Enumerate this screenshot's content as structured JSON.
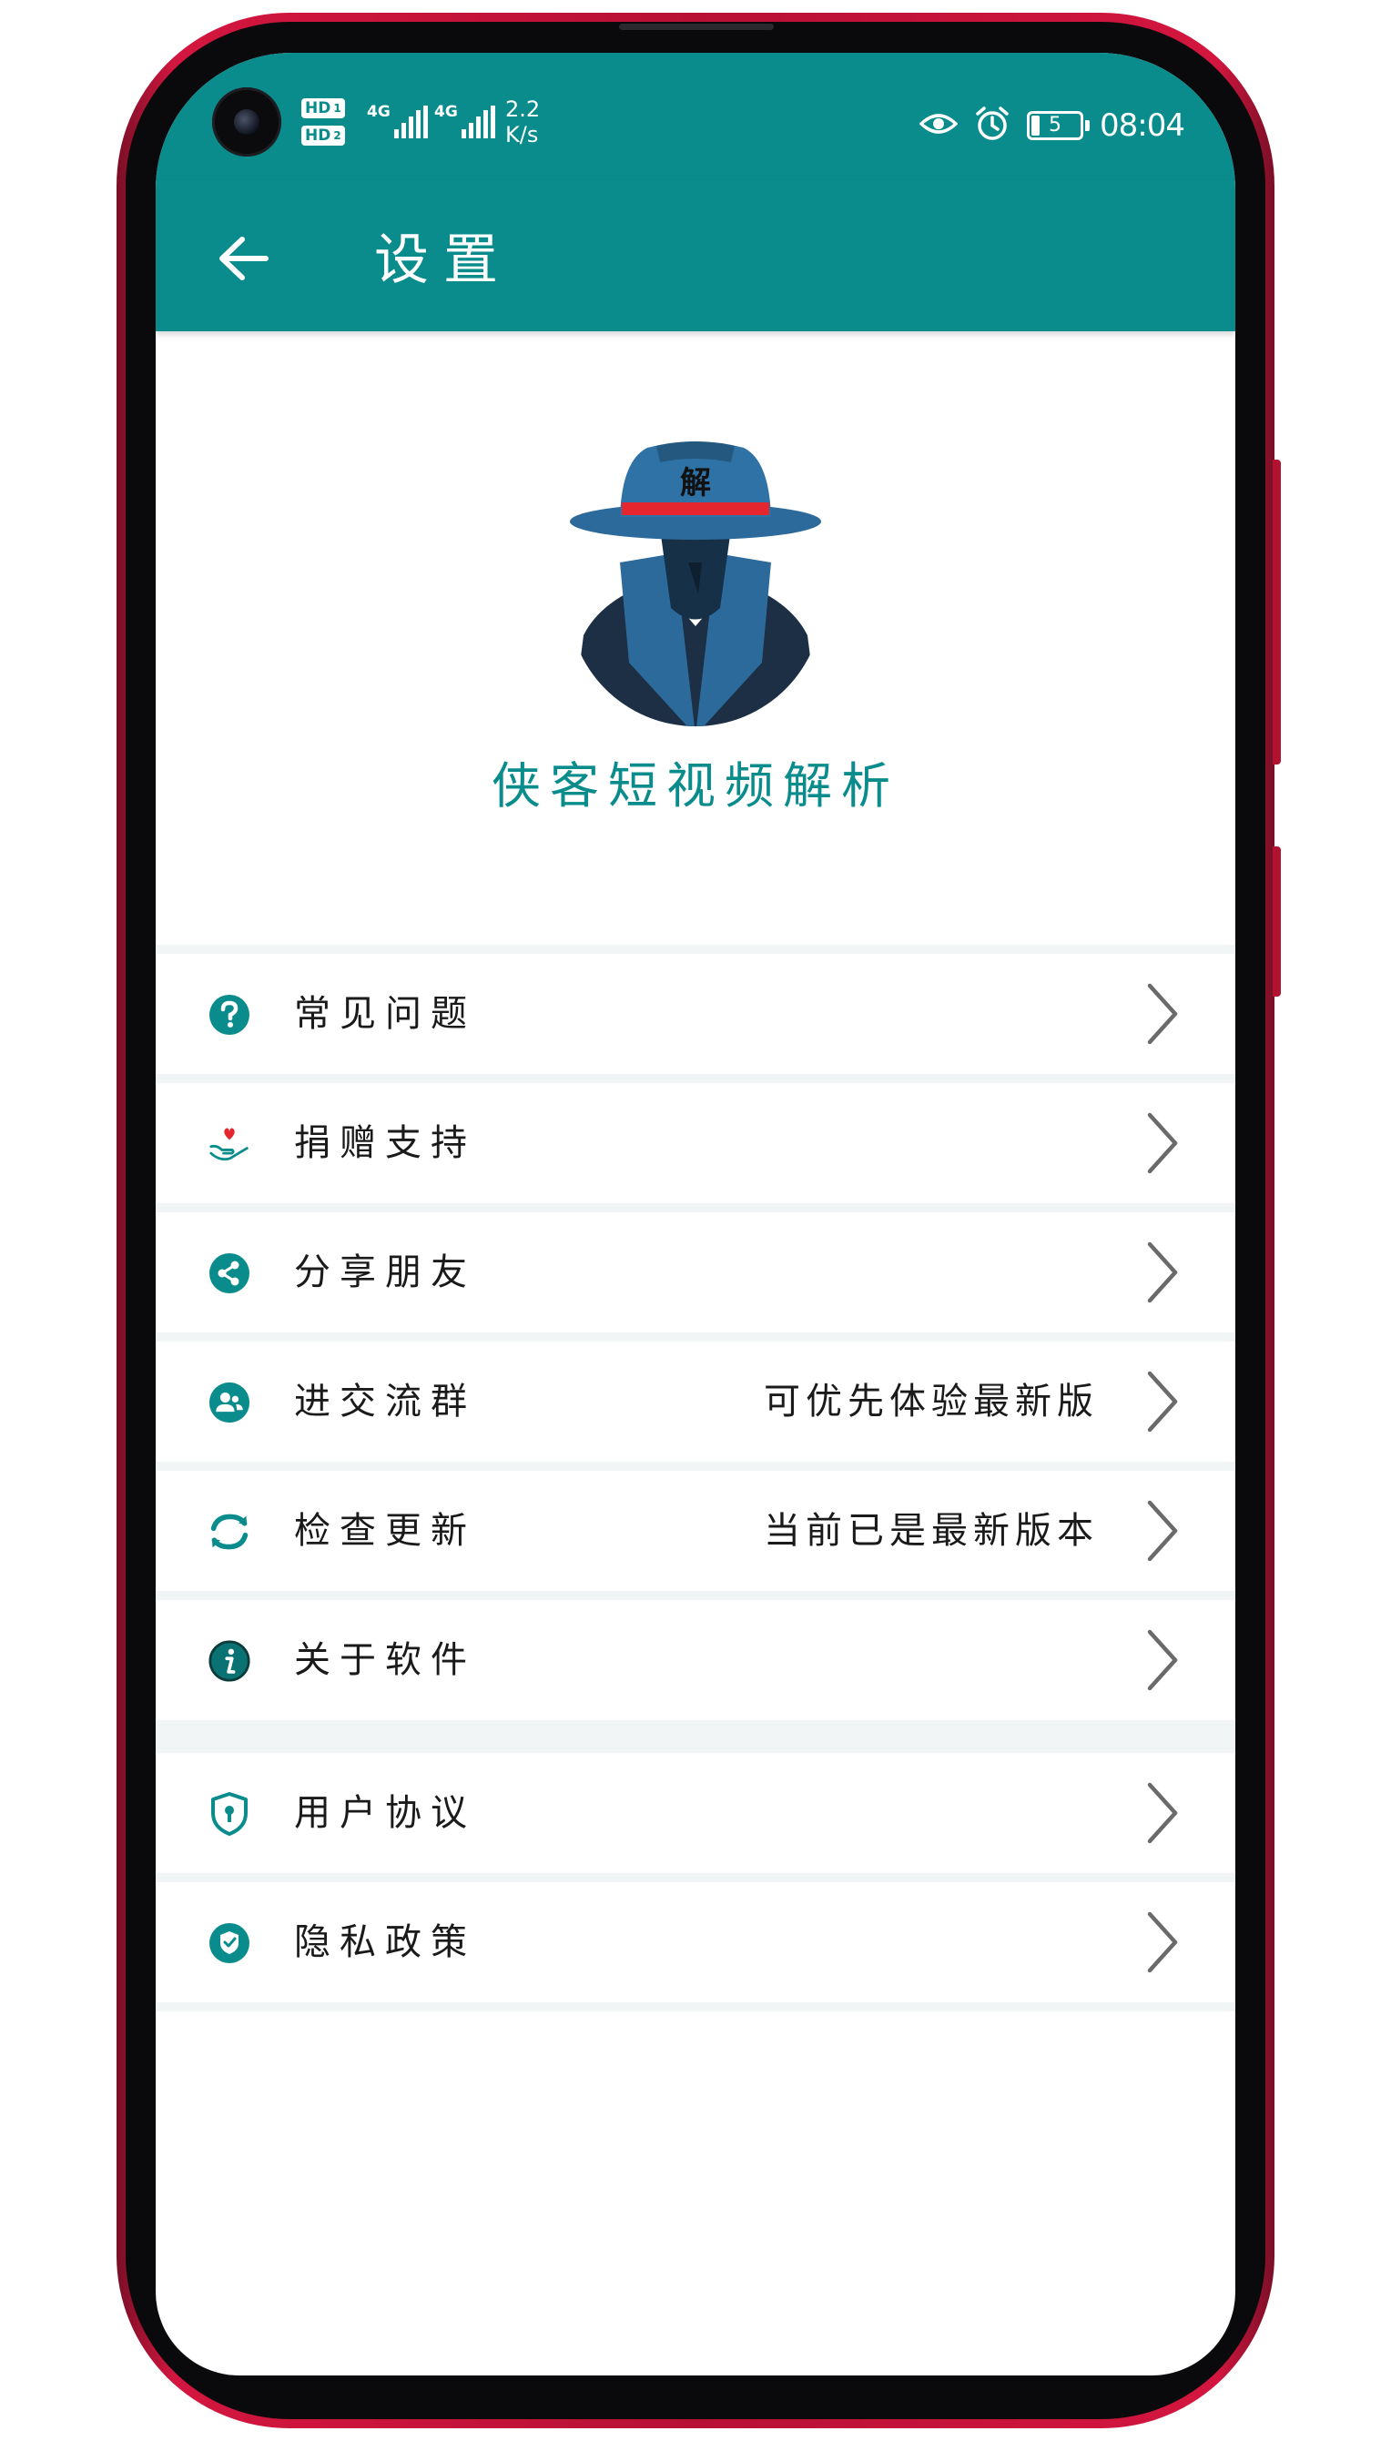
{
  "status_bar": {
    "sim1_label": "HD",
    "sim1_index": "1",
    "sim2_label": "HD",
    "sim2_index": "2",
    "net1": "4G",
    "net2": "4G",
    "speed_value": "2.2",
    "speed_unit": "K/s",
    "battery_level": "5",
    "time": "08:04"
  },
  "app_bar": {
    "title": "设置",
    "back_icon": "arrow-left-icon"
  },
  "logo": {
    "badge_text": "解",
    "app_name": "侠客短视频解析"
  },
  "colors": {
    "brand": "#0a8c8c",
    "hat_band": "#e5262e",
    "divider": "#f1f5f5"
  },
  "settings": {
    "group1": [
      {
        "label": "常见问题",
        "value": "",
        "icon": "question-circle-icon"
      },
      {
        "label": "捐赠支持",
        "value": "",
        "icon": "heart-hand-icon"
      },
      {
        "label": "分享朋友",
        "value": "",
        "icon": "share-icon"
      },
      {
        "label": "进交流群",
        "value": "可优先体验最新版",
        "icon": "group-chat-icon"
      },
      {
        "label": "检查更新",
        "value": "当前已是最新版本",
        "icon": "refresh-icon"
      },
      {
        "label": "关于软件",
        "value": "",
        "icon": "info-icon"
      }
    ],
    "group2": [
      {
        "label": "用户协议",
        "value": "",
        "icon": "shield-keyhole-icon"
      },
      {
        "label": "隐私政策",
        "value": "",
        "icon": "check-badge-icon"
      }
    ]
  }
}
